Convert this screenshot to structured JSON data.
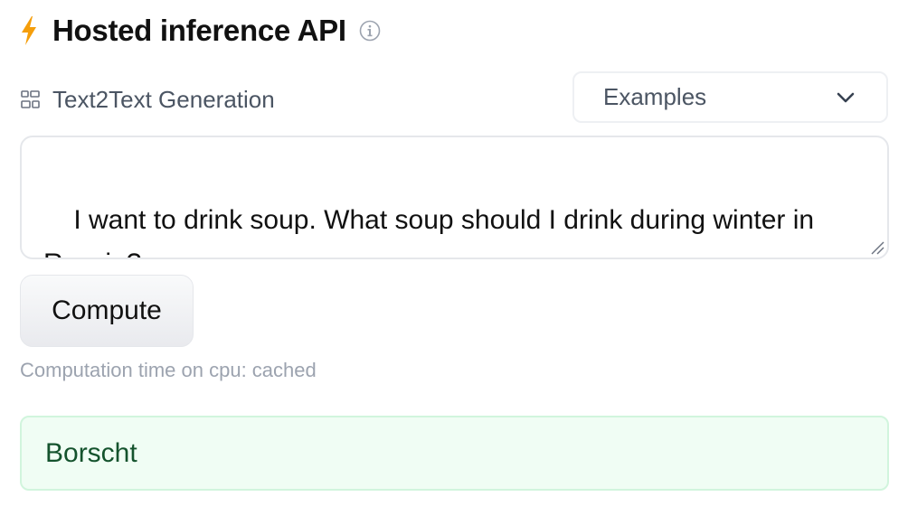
{
  "header": {
    "title": "Hosted inference API",
    "bolt_color": "#f59e0b"
  },
  "task": {
    "label": "Text2Text Generation",
    "icon": "task-icon"
  },
  "examples_select": {
    "label": "Examples"
  },
  "input": {
    "value": "I want to drink soup. What soup should I drink during winter in Russia?"
  },
  "compute_button": {
    "label": "Compute"
  },
  "computation_time": {
    "text": "Computation time on cpu: cached"
  },
  "output": {
    "text": "Borscht",
    "background": "#f0fdf4"
  }
}
